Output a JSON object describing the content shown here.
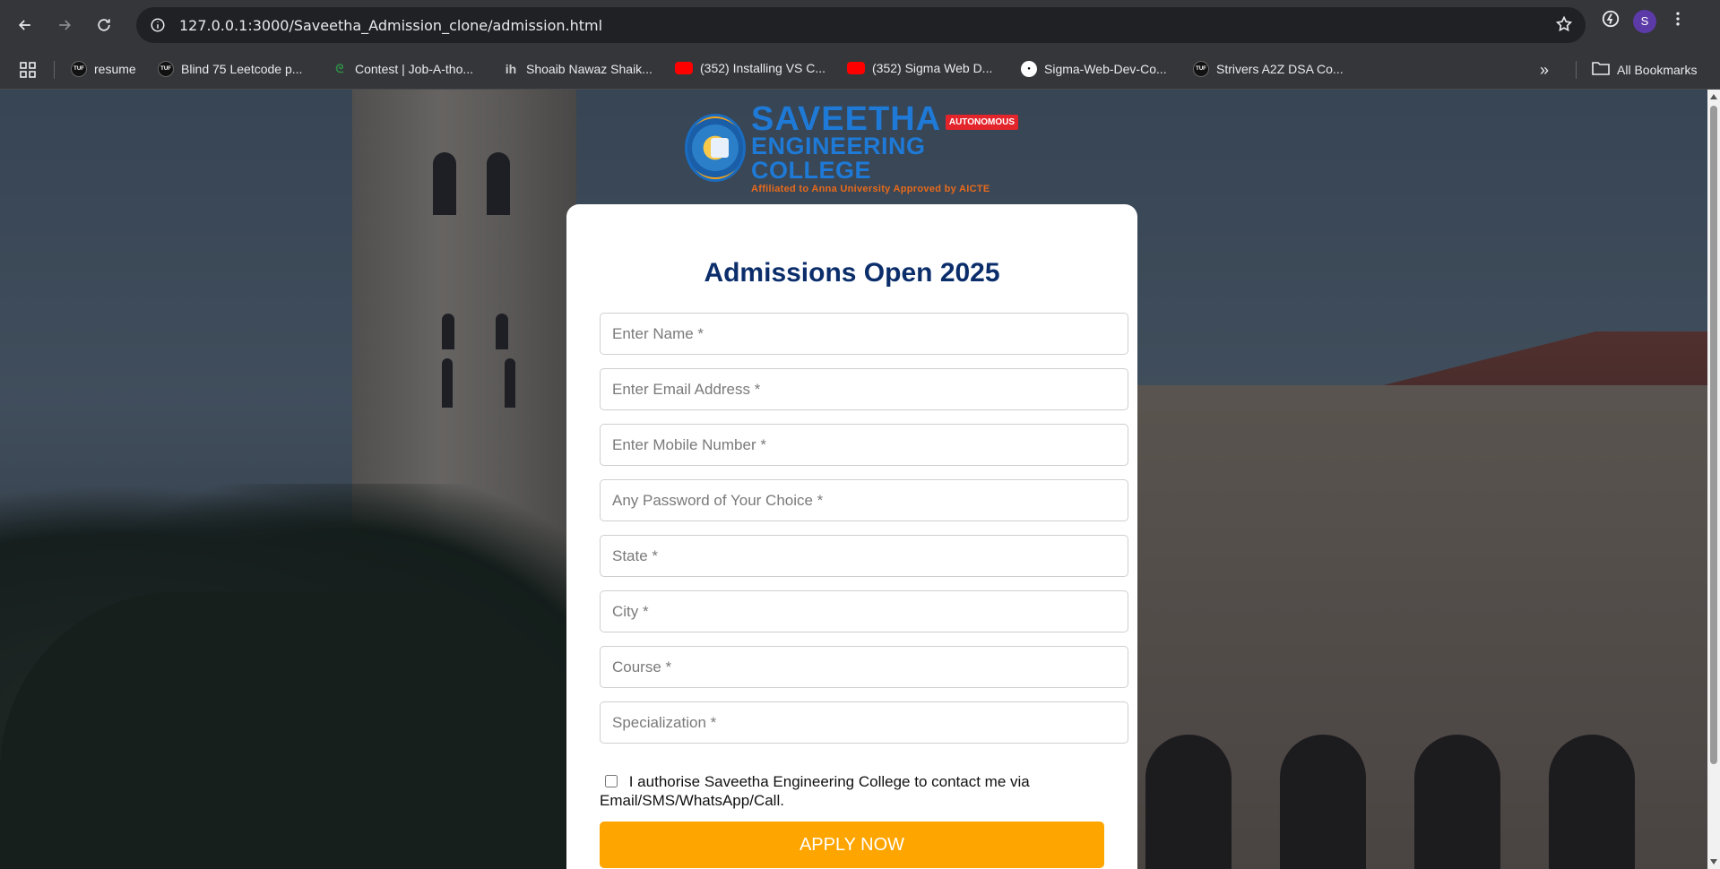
{
  "browser": {
    "url": "127.0.0.1:3000/Saveetha_Admission_clone/admission.html",
    "profile_initial": "S",
    "bookmarks": [
      {
        "label": "resume",
        "icon": "tuf-icon"
      },
      {
        "label": "Blind 75 Leetcode p...",
        "icon": "tuf-icon"
      },
      {
        "label": "Contest | Job-A-tho...",
        "icon": "gfg-icon"
      },
      {
        "label": "Shoaib Nawaz Shaik...",
        "icon": "ih-icon"
      },
      {
        "label": "(352) Installing VS C...",
        "icon": "youtube-icon"
      },
      {
        "label": "(352) Sigma Web D...",
        "icon": "youtube-icon"
      },
      {
        "label": "Sigma-Web-Dev-Co...",
        "icon": "github-icon"
      },
      {
        "label": "Strivers A2Z DSA Co...",
        "icon": "tuf-icon"
      }
    ],
    "more_bookmarks": "»",
    "all_bookmarks": "All Bookmarks"
  },
  "logo": {
    "line1": "SAVEETHA",
    "line2": "ENGINEERING COLLEGE",
    "line3": "Affiliated to Anna University  Approved by AICTE",
    "badge": "AUTONOMOUS"
  },
  "form": {
    "title": "Admissions Open 2025",
    "fields": [
      {
        "placeholder": "Enter Name *",
        "value": ""
      },
      {
        "placeholder": "Enter Email Address *",
        "value": ""
      },
      {
        "placeholder": "Enter Mobile Number *",
        "value": ""
      },
      {
        "placeholder": "Any Password of Your Choice *",
        "value": ""
      },
      {
        "placeholder": "State *",
        "value": ""
      },
      {
        "placeholder": "City *",
        "value": ""
      },
      {
        "placeholder": "Course *",
        "value": ""
      },
      {
        "placeholder": "Specialization *",
        "value": ""
      }
    ],
    "consent": "I authorise Saveetha Engineering College to contact me via Email/SMS/WhatsApp/Call.",
    "consent_checked": false,
    "submit_label": "APPLY NOW"
  },
  "colors": {
    "title": "#0b2e6b",
    "button": "#ffa500",
    "logo_blue": "#1e7ad6",
    "logo_orange": "#e86a1c"
  }
}
